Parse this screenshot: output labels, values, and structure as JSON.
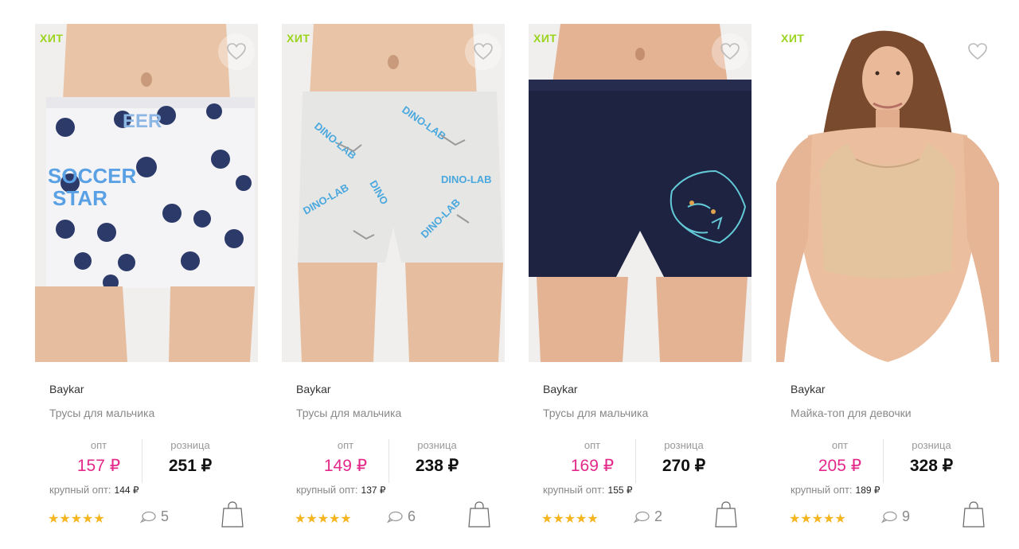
{
  "labels": {
    "badge": "ХИТ",
    "opt": "опт",
    "retail": "розница",
    "bulk": "крупный опт:",
    "stars": "★★★★★"
  },
  "colors": {
    "badge": "#9bd41e",
    "opt_price": "#e4288a",
    "stars": "#f5b51f"
  },
  "products": [
    {
      "brand": "Baykar",
      "title": "Трусы для мальчика",
      "opt_price": "157 ₽",
      "retail_price": "251 ₽",
      "bulk_price": "144 ₽",
      "rating": 5,
      "comments": "5",
      "image": "white-boxer-briefs-soccer-print"
    },
    {
      "brand": "Baykar",
      "title": "Трусы для мальчика",
      "opt_price": "149 ₽",
      "retail_price": "238 ₽",
      "bulk_price": "137 ₽",
      "rating": 5,
      "comments": "6",
      "image": "grey-boxer-briefs-dino-lab-print"
    },
    {
      "brand": "Baykar",
      "title": "Трусы для мальчика",
      "opt_price": "169 ₽",
      "retail_price": "270 ₽",
      "bulk_price": "155 ₽",
      "rating": 5,
      "comments": "2",
      "image": "navy-boxer-briefs-tiger-print"
    },
    {
      "brand": "Baykar",
      "title": "Майка-топ для девочки",
      "opt_price": "205 ₽",
      "retail_price": "328 ₽",
      "bulk_price": "189 ₽",
      "rating": 5,
      "comments": "9",
      "image": "beige-crop-top-girl"
    }
  ]
}
